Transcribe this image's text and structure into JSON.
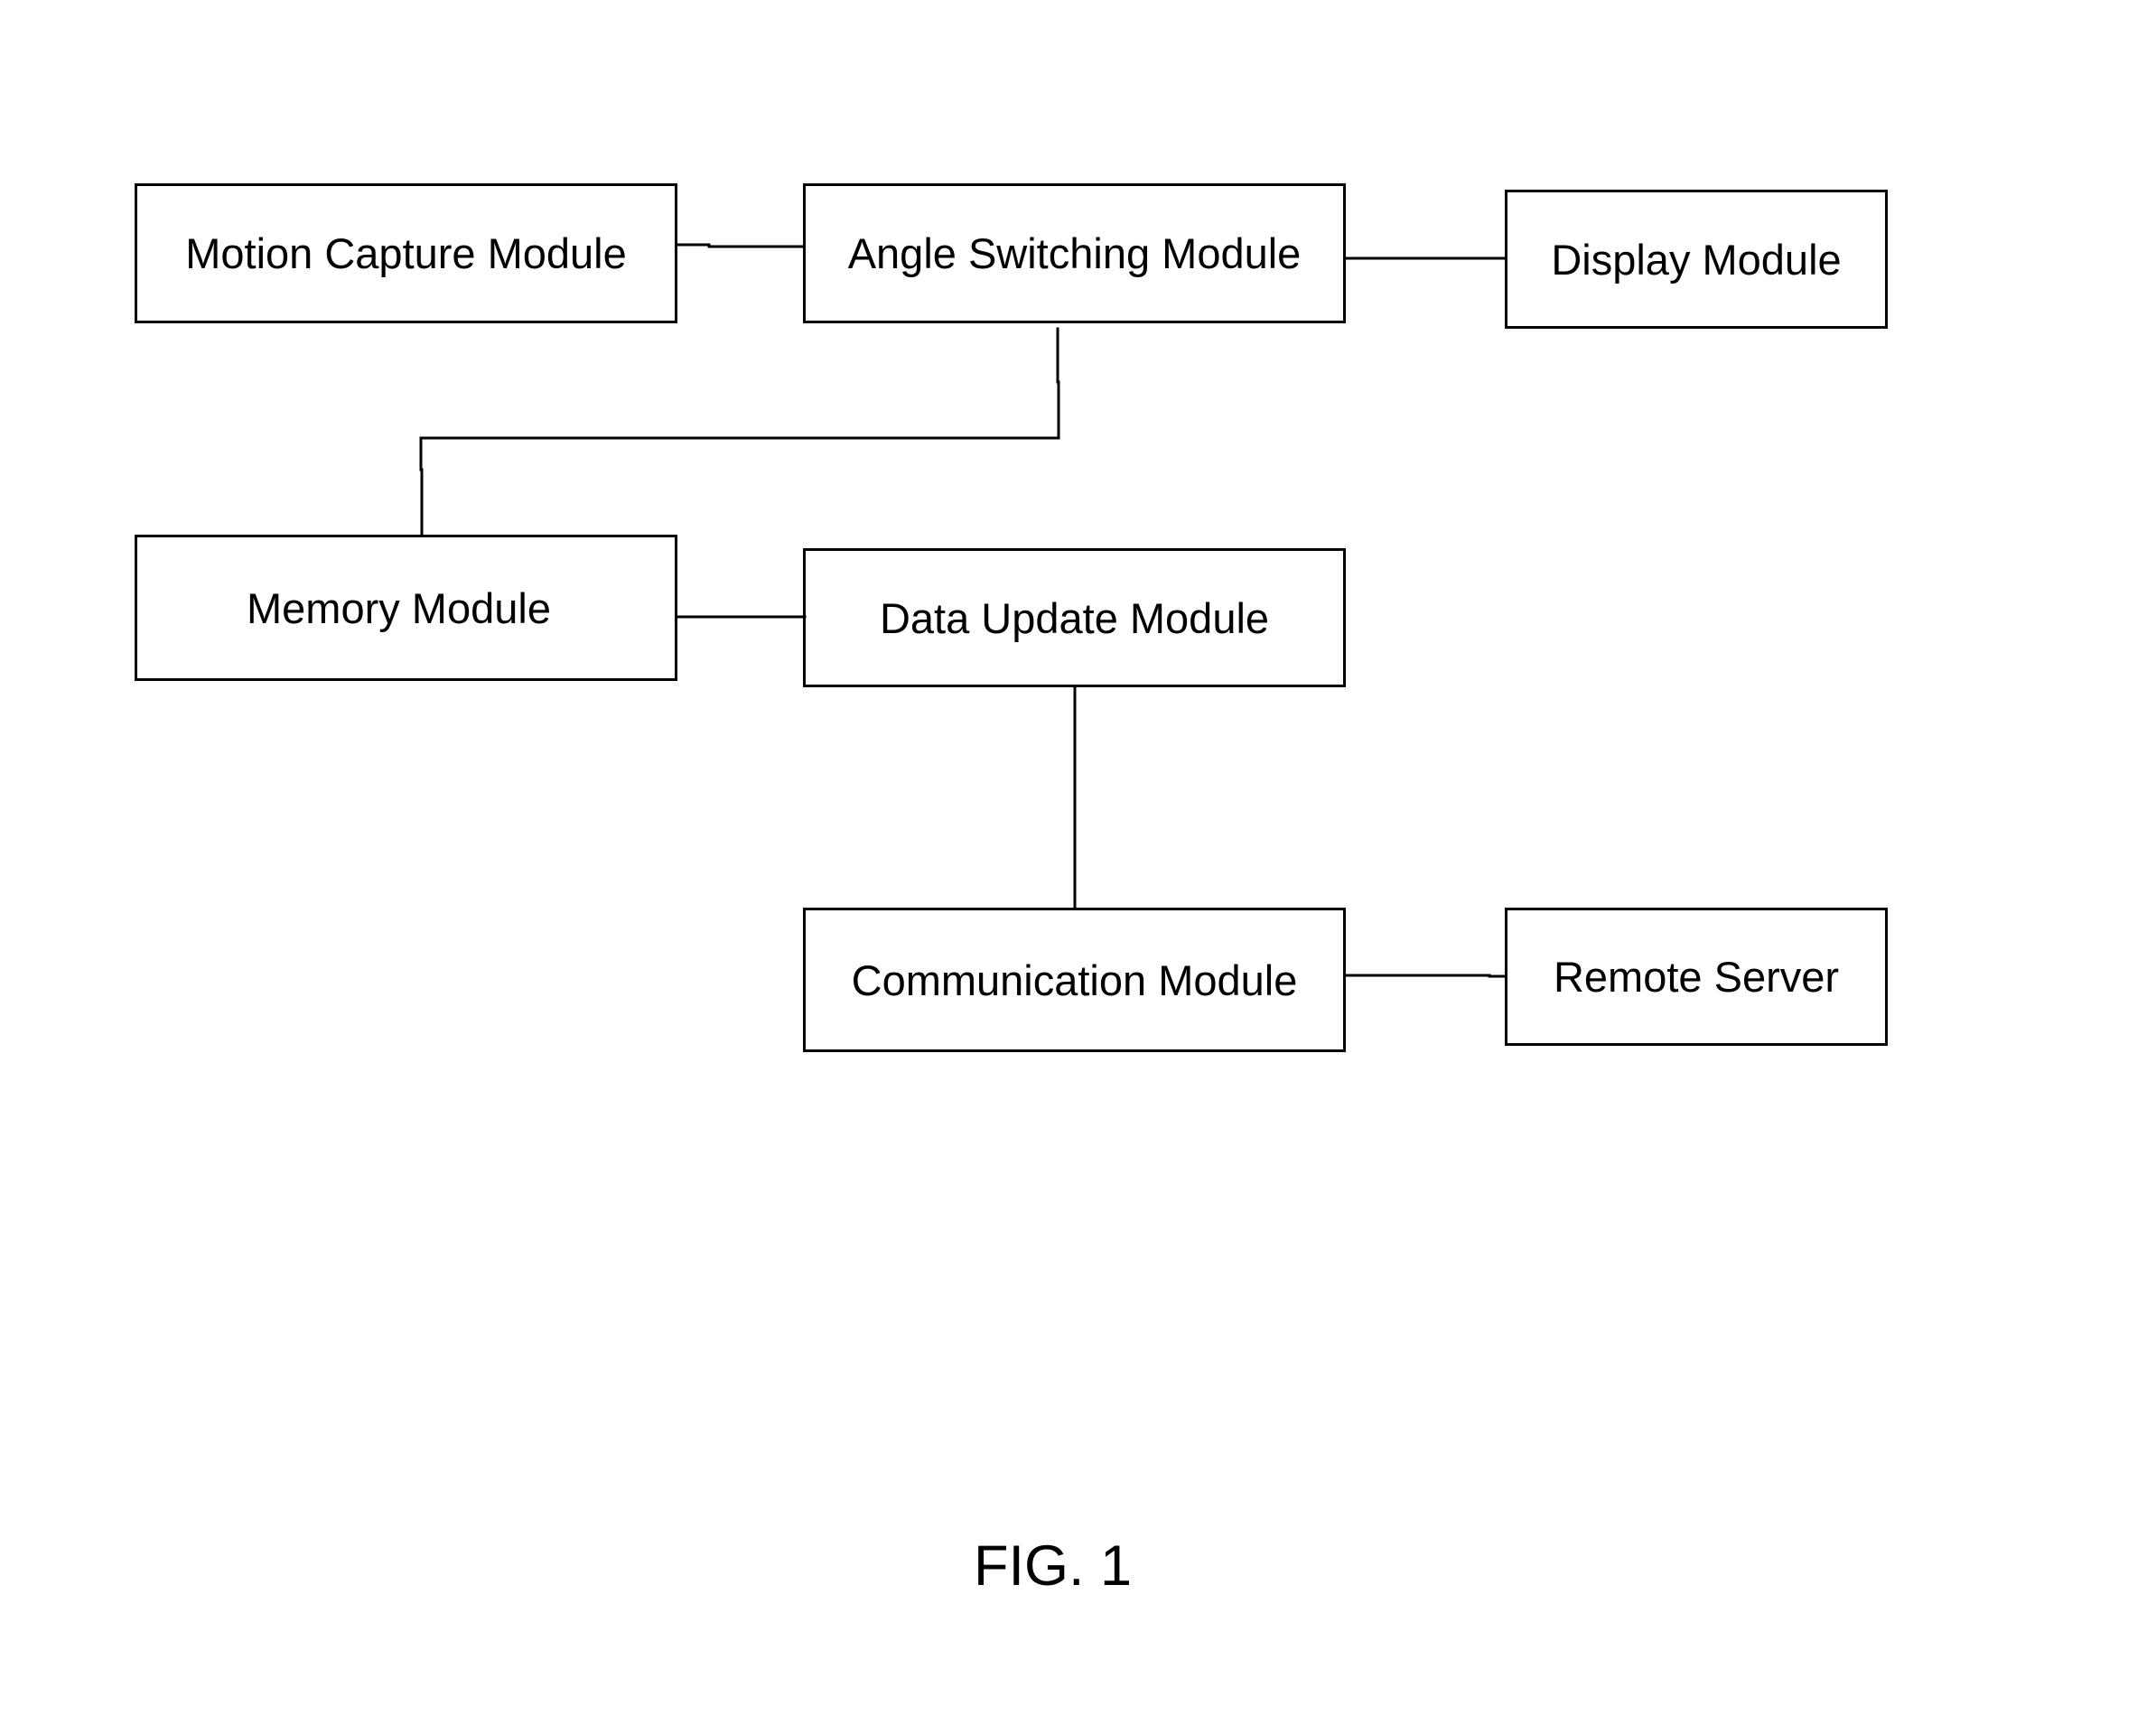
{
  "figure": {
    "caption": "FIG. 1",
    "type": "block diagram"
  },
  "nodes": {
    "motion_capture": "Motion Capture Module",
    "angle_switching": "Angle Switching Module",
    "display": "Display Module",
    "memory": "Memory Module",
    "data_update": "Data Update Module",
    "communication": "Communication Module",
    "remote_server": "Remote Server"
  },
  "edges": [
    {
      "from": "Motion Capture Module",
      "to": "Angle Switching Module"
    },
    {
      "from": "Angle Switching Module",
      "to": "Display Module"
    },
    {
      "from": "Angle Switching Module",
      "to": "Memory Module"
    },
    {
      "from": "Memory Module",
      "to": "Data Update Module"
    },
    {
      "from": "Data Update Module",
      "to": "Communication Module"
    },
    {
      "from": "Communication Module",
      "to": "Remote Server"
    }
  ],
  "colors": {
    "line": "#000000",
    "background": "#ffffff",
    "text": "#000000"
  }
}
